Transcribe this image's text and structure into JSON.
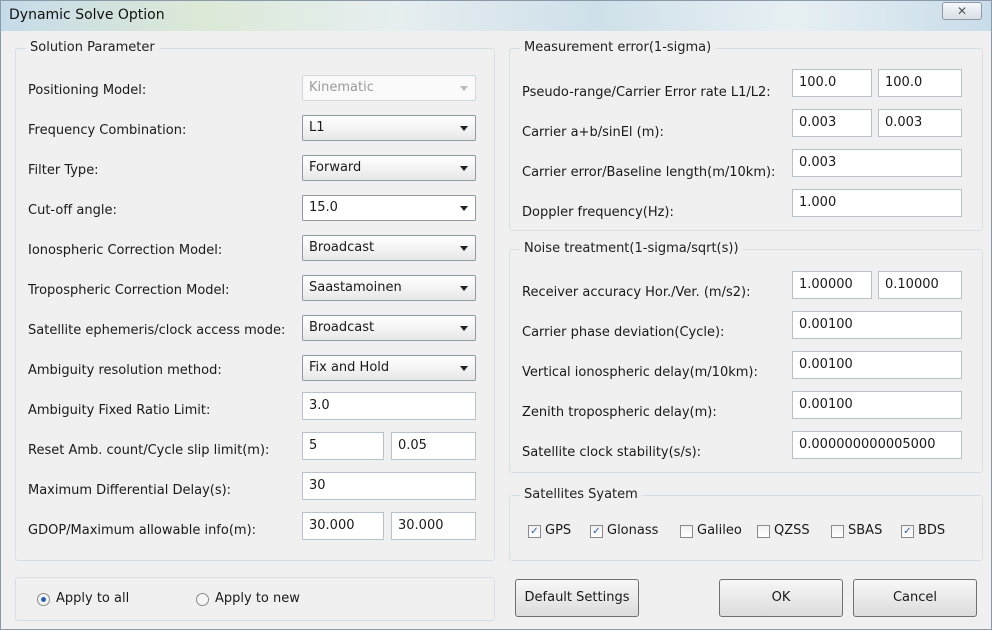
{
  "window": {
    "title": "Dynamic Solve Option",
    "close_glyph": "✕"
  },
  "solution": {
    "group_title": "Solution Parameter",
    "positioning_model": {
      "label": "Positioning Model:",
      "value": "Kinematic"
    },
    "frequency_combination": {
      "label": "Frequency Combination:",
      "value": "L1"
    },
    "filter_type": {
      "label": "Filter Type:",
      "value": "Forward"
    },
    "cutoff_angle": {
      "label": "Cut-off angle:",
      "value": "15.0"
    },
    "ionospheric_model": {
      "label": "Ionospheric Correction Model:",
      "value": "Broadcast"
    },
    "tropospheric_model": {
      "label": "Tropospheric Correction Model:",
      "value": "Saastamoinen"
    },
    "ephemeris_mode": {
      "label": "Satellite ephemeris/clock access mode:",
      "value": "Broadcast"
    },
    "ambiguity_method": {
      "label": "Ambiguity resolution method:",
      "value": "Fix and Hold"
    },
    "ambiguity_ratio": {
      "label": "Ambiguity Fixed Ratio Limit:",
      "value": "3.0"
    },
    "reset_amb": {
      "label": "Reset Amb. count/Cycle slip limit(m):",
      "value1": "5",
      "value2": "0.05"
    },
    "max_diff_delay": {
      "label": "Maximum Differential Delay(s):",
      "value": "30"
    },
    "gdop": {
      "label": "GDOP/Maximum allowable info(m):",
      "value1": "30.000",
      "value2": "30.000"
    }
  },
  "measurement": {
    "group_title": "Measurement error(1-sigma)",
    "pseudo_range": {
      "label": "Pseudo-range/Carrier Error rate L1/L2:",
      "value1": "100.0",
      "value2": "100.0"
    },
    "carrier_ab": {
      "label": "Carrier a+b/sinEl (m):",
      "value1": "0.003",
      "value2": "0.003"
    },
    "carrier_baseline": {
      "label": "Carrier error/Baseline length(m/10km):",
      "value": "0.003"
    },
    "doppler": {
      "label": "Doppler frequency(Hz):",
      "value": "1.000"
    }
  },
  "noise": {
    "group_title": "Noise treatment(1-sigma/sqrt(s))",
    "receiver_accuracy": {
      "label": "Receiver accuracy Hor./Ver. (m/s2):",
      "value1": "1.00000",
      "value2": "0.10000"
    },
    "carrier_phase": {
      "label": "Carrier phase deviation(Cycle):",
      "value": "0.00100"
    },
    "vertical_iono": {
      "label": "Vertical ionospheric delay(m/10km):",
      "value": "0.00100"
    },
    "zenith_tropo": {
      "label": "Zenith tropospheric delay(m):",
      "value": "0.00100"
    },
    "clock_stability": {
      "label": "Satellite clock stability(s/s):",
      "value": "0.000000000005000"
    }
  },
  "satellites": {
    "group_title": "Satellites Syatem",
    "items": [
      {
        "label": "GPS",
        "checked": true
      },
      {
        "label": "Glonass",
        "checked": true
      },
      {
        "label": "Galileo",
        "checked": false
      },
      {
        "label": "QZSS",
        "checked": false
      },
      {
        "label": "SBAS",
        "checked": false
      },
      {
        "label": "BDS",
        "checked": true
      }
    ]
  },
  "apply": {
    "all_label": "Apply to all",
    "new_label": "Apply to new",
    "selected": "all"
  },
  "buttons": {
    "default": "Default Settings",
    "ok": "OK",
    "cancel": "Cancel"
  },
  "check_glyph": "✓"
}
